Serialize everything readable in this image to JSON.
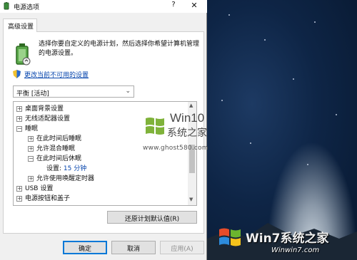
{
  "window": {
    "title": "电源选项",
    "help_label": "?",
    "close_label": "✕"
  },
  "tabs": [
    {
      "label": "高级设置"
    }
  ],
  "description": "选择你要自定义的电源计划，然后选择你希望计算机管理的电源设置。",
  "change_link": "更改当前不可用的设置",
  "plan_select": {
    "value": "平衡 [活动]"
  },
  "tree": {
    "rows": [
      {
        "toggle": "+",
        "label": "桌面背景设置"
      },
      {
        "toggle": "+",
        "label": "无线适配器设置"
      },
      {
        "toggle": "−",
        "label": "睡眠"
      },
      {
        "toggle": "+",
        "label": "在此时间后睡眠"
      },
      {
        "toggle": "+",
        "label": "允许混合睡眠"
      },
      {
        "toggle": "−",
        "label": "在此时间后休眠"
      },
      {
        "label": "设置:",
        "value": "15 分钟"
      },
      {
        "toggle": "+",
        "label": "允许使用唤醒定时器"
      },
      {
        "toggle": "+",
        "label": "USB 设置"
      },
      {
        "toggle": "+",
        "label": "电源按钮和盖子"
      }
    ]
  },
  "buttons": {
    "restore": "还原计划默认值(R)",
    "ok": "确定",
    "cancel": "取消",
    "apply": "应用(A)"
  },
  "watermark_center": {
    "line1": "Win10",
    "line2": "系统之家",
    "url": "www.ghost580.com"
  },
  "watermark_corner": {
    "brand": "Win7系统之家",
    "url": "Winwin7.com"
  },
  "colors": {
    "link": "#0645ad",
    "accent": "#0078d7"
  }
}
